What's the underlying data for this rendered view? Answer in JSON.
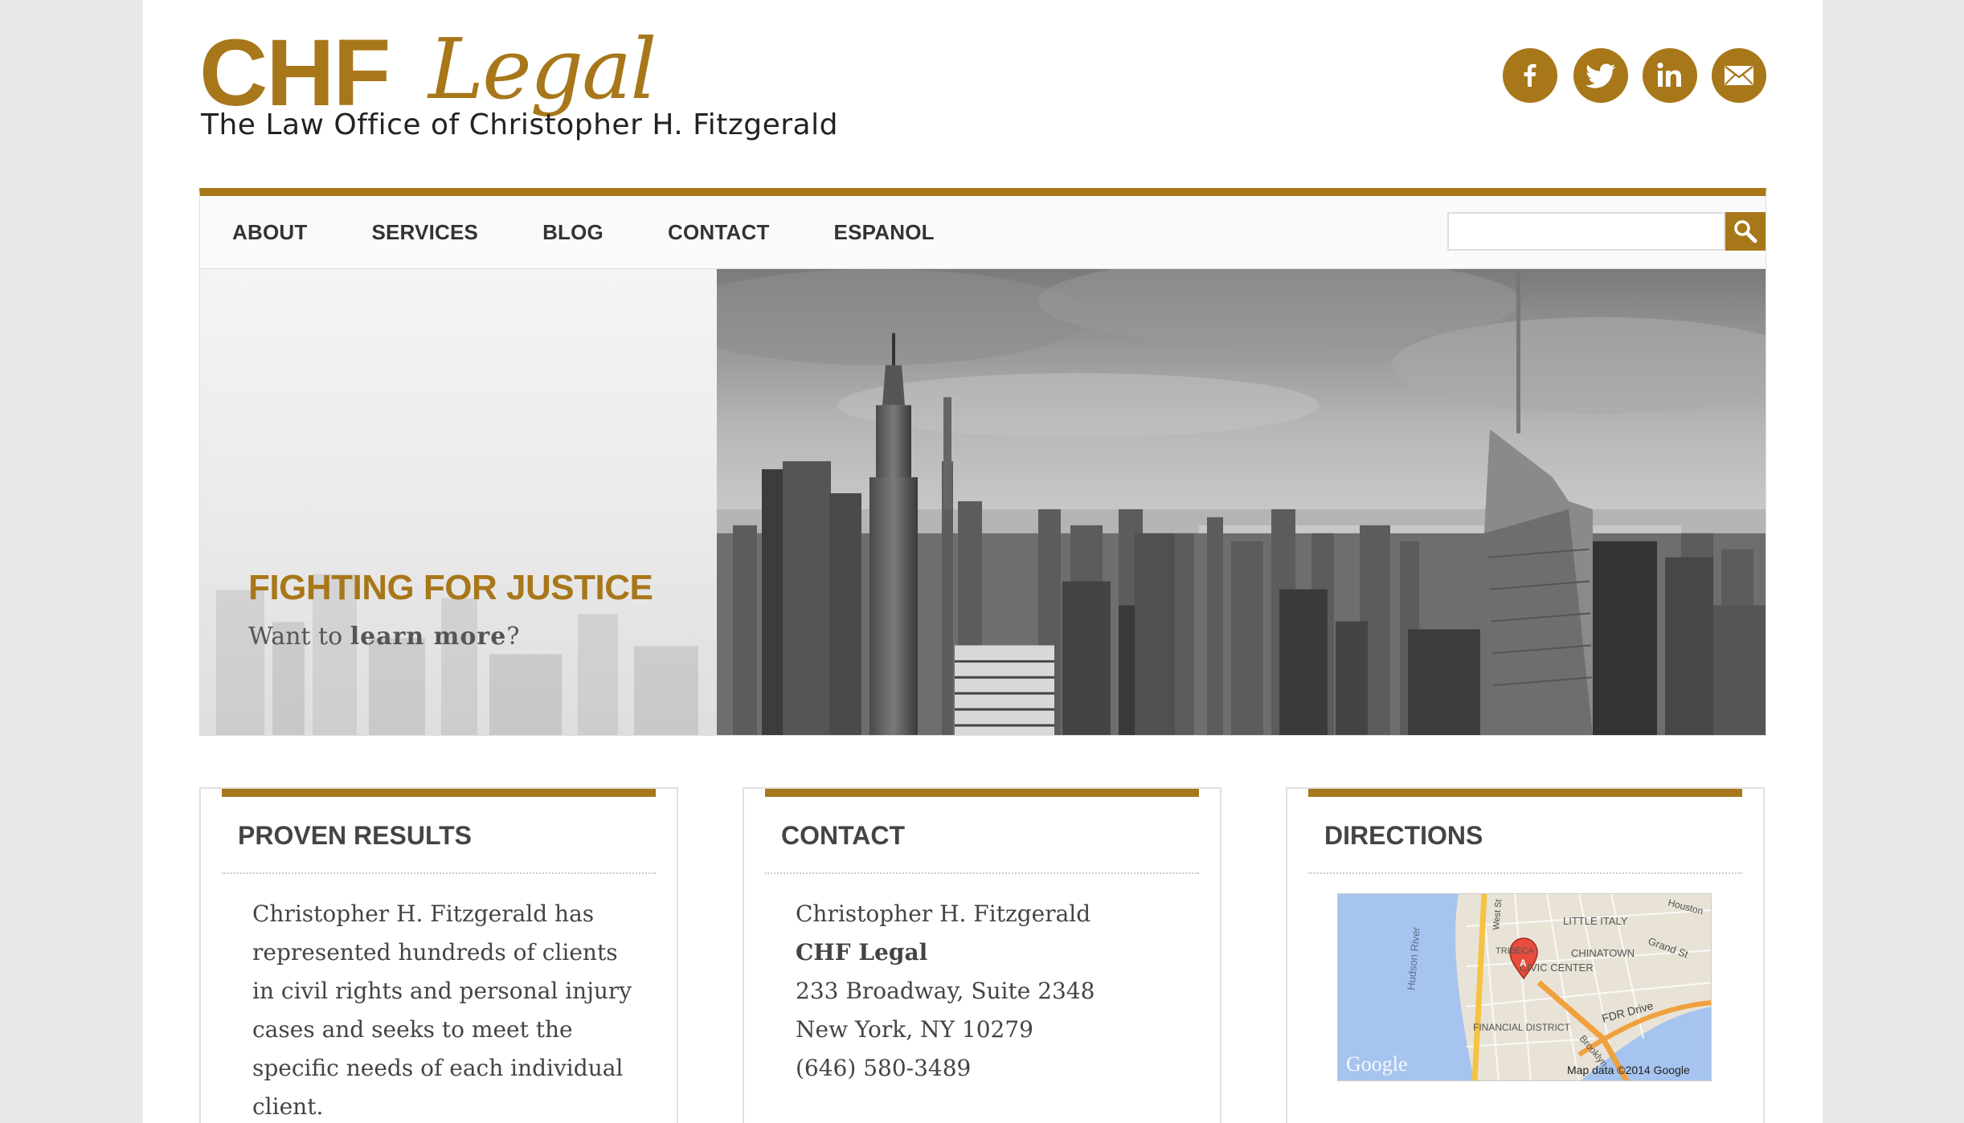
{
  "header": {
    "logo_main": "CHF",
    "logo_script": "Legal",
    "tagline": "The Law Office of Christopher H. Fitzgerald",
    "social": [
      {
        "icon": "facebook-icon",
        "glyph": "f"
      },
      {
        "icon": "twitter-icon",
        "glyph": "🐦"
      },
      {
        "icon": "linkedin-icon",
        "glyph": "in"
      },
      {
        "icon": "email-icon",
        "glyph": "✉"
      }
    ]
  },
  "nav": {
    "items": [
      "ABOUT",
      "SERVICES",
      "BLOG",
      "CONTACT",
      "ESPANOL"
    ],
    "search_placeholder": ""
  },
  "hero": {
    "title": "FIGHTING FOR JUSTICE",
    "sub_prefix": "Want to ",
    "sub_link": "learn more",
    "sub_suffix": "?"
  },
  "cards": {
    "results": {
      "title": "PROVEN RESULTS",
      "text": "Christopher H. Fitzgerald has represented hundreds of clients in civil rights and personal injury cases and seeks to meet the specific needs of each individual client."
    },
    "contact": {
      "title": "CONTACT",
      "name": "Christopher H. Fitzgerald",
      "firm": "CHF Legal",
      "address1": "233 Broadway, Suite 2348",
      "address2": "New York, NY 10279",
      "phone": "(646) 580-3489"
    },
    "directions": {
      "title": "DIRECTIONS",
      "map_labels": {
        "hudson": "Hudson River",
        "west": "West St",
        "little_italy": "LITTLE ITALY",
        "grand": "Grand St",
        "chinatown": "CHINATOWN",
        "civic": "CIVIC CENTER",
        "tribeca": "TRIBECA",
        "fdr": "FDR Drive",
        "financial": "FINANCIAL DISTRICT",
        "brooklyn": "Brooklyn",
        "houston": "Houston",
        "google": "Google",
        "mapdata": "Map data ©2014 Google",
        "marker": "A"
      }
    }
  },
  "colors": {
    "accent": "#a8771a"
  }
}
